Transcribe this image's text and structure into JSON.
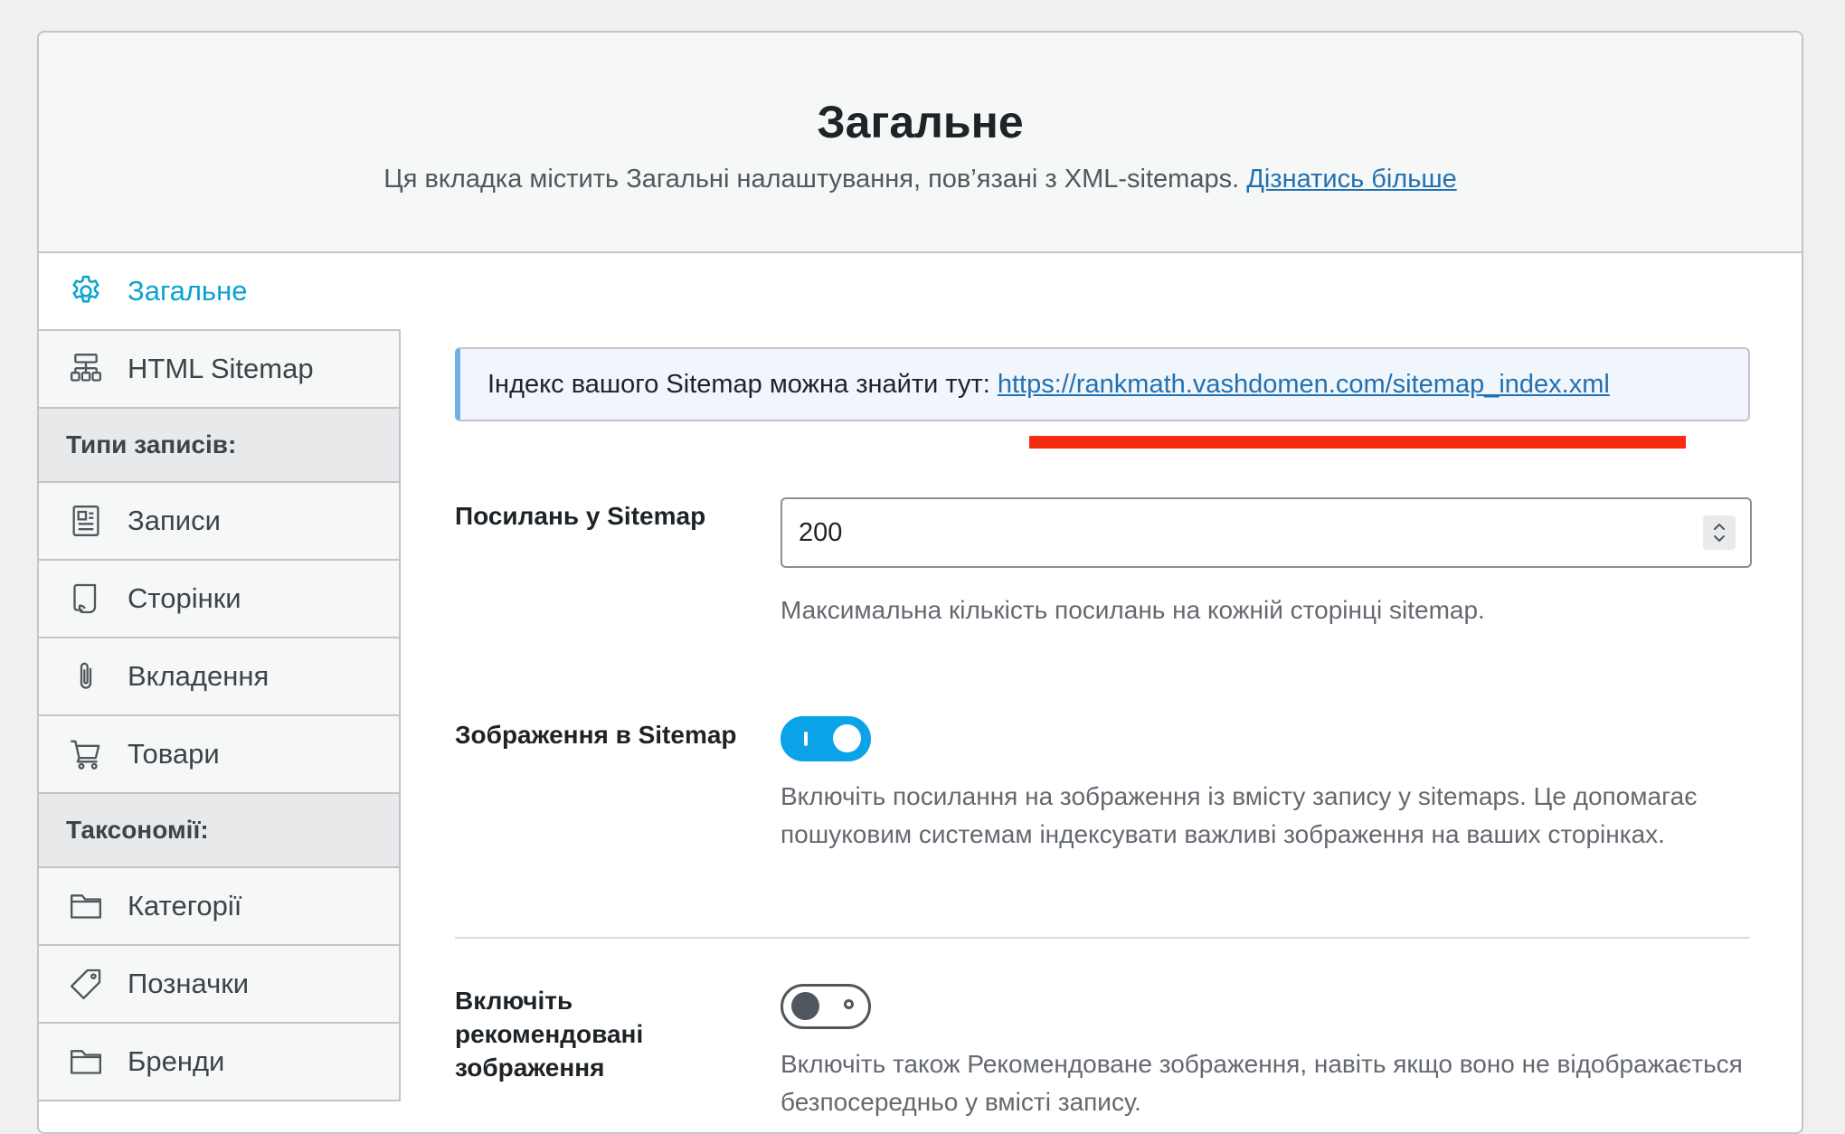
{
  "header": {
    "title": "Загальне",
    "description": "Ця вкладка містить Загальні налаштування, пов’язані з XML-sitemaps.",
    "learn_more": "Дізнатись більше"
  },
  "sidebar": {
    "items": [
      {
        "label": "Загальне",
        "icon": "gear-icon",
        "active": true
      },
      {
        "label": "HTML Sitemap",
        "icon": "sitemap-icon"
      }
    ],
    "post_types_heading": "Типи записів:",
    "post_types": [
      {
        "label": "Записи",
        "icon": "post-icon"
      },
      {
        "label": "Сторінки",
        "icon": "page-icon"
      },
      {
        "label": "Вкладення",
        "icon": "paperclip-icon"
      },
      {
        "label": "Товари",
        "icon": "cart-icon"
      }
    ],
    "taxonomies_heading": "Таксономії:",
    "taxonomies": [
      {
        "label": "Категорії",
        "icon": "folder-icon"
      },
      {
        "label": "Позначки",
        "icon": "tag-icon"
      },
      {
        "label": "Бренди",
        "icon": "folder-icon"
      }
    ]
  },
  "notice": {
    "text": "Індекс вашого Sitemap можна знайти тут:",
    "link": "https://rankmath.vashdomen.com/sitemap_index.xml"
  },
  "fields": {
    "links_per_sitemap": {
      "label": "Посилань у Sitemap",
      "value": "200",
      "help": "Максимальна кількість посилань на кожній сторінці sitemap."
    },
    "images_in_sitemap": {
      "label": "Зображення в Sitemap",
      "enabled": true,
      "help": "Включіть посилання на зображення із вмісту запису у sitemaps. Це допомагає пошуковим системам індексувати важливі зображення на ваших сторінках."
    },
    "featured_images": {
      "label": "Включіть рекомендовані зображення",
      "enabled": false,
      "help": "Включіть також Рекомендоване зображення, навіть якщо воно не відображається безпосередньо у вмісті запису."
    }
  },
  "colors": {
    "accent": "#0aa3cf",
    "link": "#2271b1",
    "highlight": "#f62c0e"
  }
}
